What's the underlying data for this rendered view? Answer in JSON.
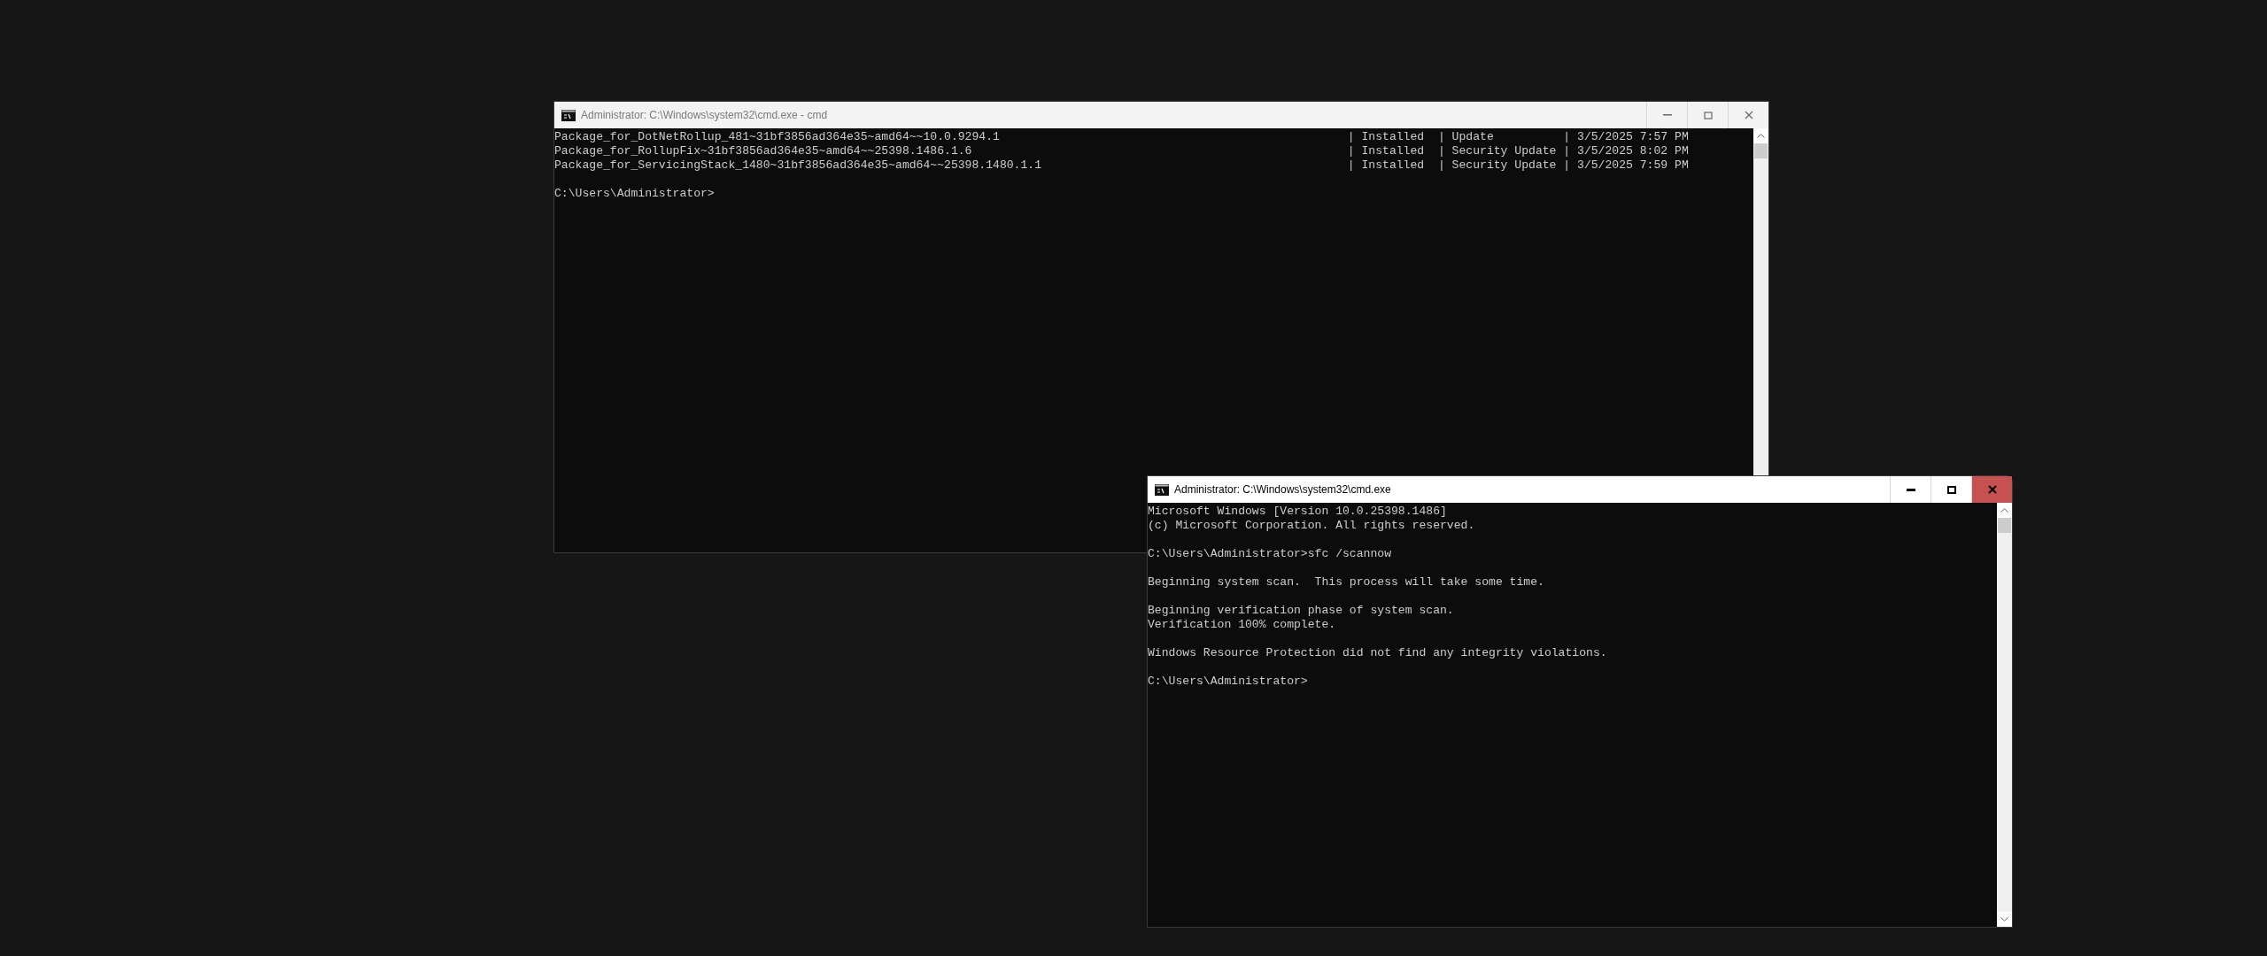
{
  "windows": [
    {
      "title": "Administrator: C:\\Windows\\system32\\cmd.exe - cmd",
      "active": false,
      "close_hovered": false,
      "package_rows": [
        {
          "package": "Package_for_DotNetRollup_481~31bf3856ad364e35~amd64~~10.0.9294.1",
          "details": "| Installed  | Update          | 3/5/2025 7:57 PM"
        },
        {
          "package": "Package_for_RollupFix~31bf3856ad364e35~amd64~~25398.1486.1.6",
          "details": "| Installed  | Security Update | 3/5/2025 8:02 PM"
        },
        {
          "package": "Package_for_ServicingStack_1480~31bf3856ad364e35~amd64~~25398.1480.1.1",
          "details": "| Installed  | Security Update | 3/5/2025 7:59 PM"
        }
      ],
      "blocks": [
        [
          "C:\\Users\\Administrator>"
        ]
      ]
    },
    {
      "title": "Administrator: C:\\Windows\\system32\\cmd.exe",
      "active": true,
      "close_hovered": true,
      "blocks": [
        [
          "Microsoft Windows [Version 10.0.25398.1486]",
          "(c) Microsoft Corporation. All rights reserved."
        ],
        [
          "C:\\Users\\Administrator>sfc /scannow"
        ],
        [
          "Beginning system scan.  This process will take some time."
        ],
        [
          "Beginning verification phase of system scan.",
          "Verification 100% complete."
        ],
        [
          "Windows Resource Protection did not find any integrity violations."
        ],
        [
          "C:\\Users\\Administrator>"
        ]
      ]
    }
  ]
}
